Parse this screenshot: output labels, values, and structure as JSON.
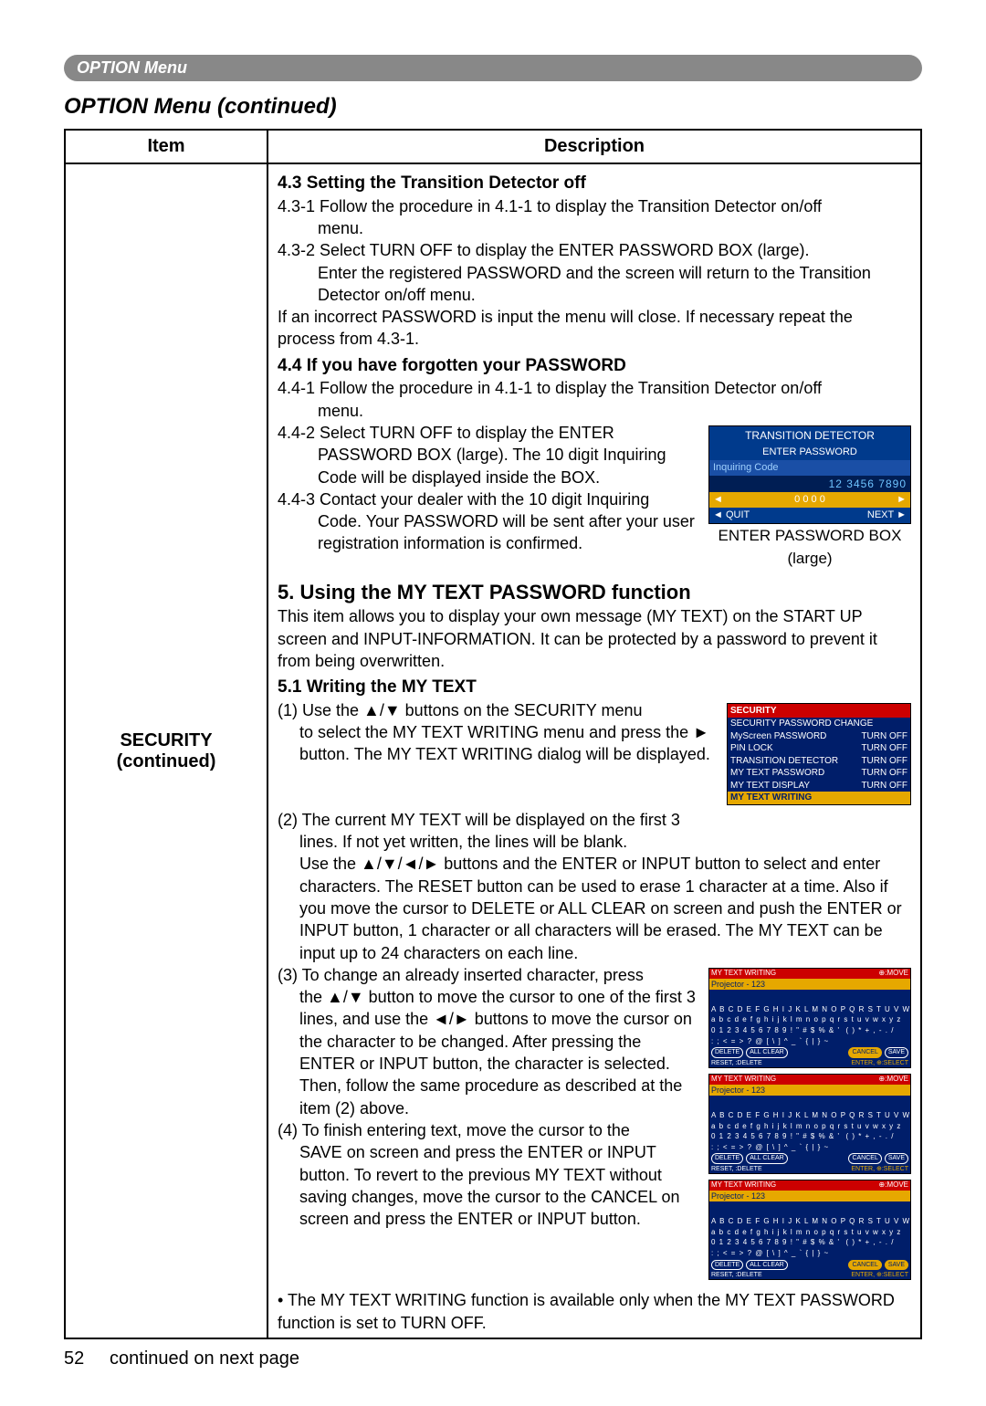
{
  "page": {
    "header_bar": "OPTION Menu",
    "section_title": "OPTION Menu (continued)",
    "page_number": "52",
    "continued": "continued on next page"
  },
  "table": {
    "col_item": "Item",
    "col_desc": "Description",
    "item_label_line1": "SECURITY",
    "item_label_line2": "(continued)"
  },
  "s43": {
    "title": "4.3 Setting the Transition Detector off",
    "p1a": "4.3-1 Follow the procedure in 4.1-1 to display the Transition Detector on/off",
    "p1b": "menu.",
    "p2a": "4.3-2 Select TURN OFF to display the ENTER PASSWORD BOX (large).",
    "p2b": "Enter the registered PASSWORD and the screen will return to the Transition Detector on/off menu.",
    "p3": "If an incorrect PASSWORD is input the menu will close. If necessary repeat the process from 4.3-1."
  },
  "s44": {
    "title": "4.4 If you have forgotten your PASSWORD",
    "p1a": "4.4-1 Follow the procedure in 4.1-1 to display the Transition Detector on/off",
    "p1b": "menu.",
    "p2a": "4.4-2 Select TURN OFF to display the ENTER",
    "p2b": "PASSWORD BOX (large). The 10 digit Inquiring Code will be displayed inside the BOX.",
    "p3a": "4.4-3 Contact your dealer with the 10 digit Inquiring",
    "p3b": "Code. Your PASSWORD will be sent after your user registration information is confirmed."
  },
  "s5": {
    "title": "5. Using the MY TEXT PASSWORD function",
    "intro": "This item allows you to display your own message (MY TEXT) on the START UP screen and INPUT-INFORMATION. It can be protected by a password to prevent it from being overwritten."
  },
  "s51": {
    "title": "5.1 Writing the MY TEXT",
    "p1a": "(1) Use the ▲/▼ buttons on the SECURITY menu",
    "p1b": "to select the MY TEXT WRITING menu and press the ► button. The MY TEXT WRITING dialog will be displayed.",
    "p2a": "(2) The current MY TEXT will be displayed on the first 3",
    "p2b": "lines. If not yet written, the lines will be blank.",
    "p2c": "Use the ▲/▼/◄/► buttons and the ENTER or INPUT button to select and enter characters. The RESET button can be used to erase 1 character at a time. Also if you move the cursor to DELETE or ALL CLEAR on screen and push the ENTER or INPUT button, 1 character or all characters will be erased. The MY TEXT can be input up to 24 characters on each line.",
    "p3a": "(3) To change an already inserted character, press",
    "p3b": "the ▲/▼ button to move the cursor to one of the first 3 lines, and use the ◄/► buttons to move the cursor on the character to be changed. After pressing the ENTER or INPUT button, the character is selected. Then, follow the same procedure as described at the item (2) above.",
    "p4a": "(4) To finish entering text, move the cursor to the",
    "p4b": "SAVE on screen and press the ENTER or INPUT button. To revert to the previous MY TEXT without saving changes, move the cursor to the CANCEL on screen and press the ENTER or INPUT button.",
    "note": "• The MY TEXT WRITING function is available only when the MY TEXT PASSWORD function is set to TURN OFF."
  },
  "pwbox": {
    "title1": "TRANSITION DETECTOR",
    "title2": "ENTER PASSWORD",
    "code_label": "Inquiring Code",
    "code_value": "12 3456 7890",
    "digits_row_left": "◄",
    "digits_row_val": "0 0 0 0",
    "digits_row_right": "►",
    "quit": "◄ QUIT",
    "next": "NEXT ►",
    "caption1": "ENTER PASSWORD BOX",
    "caption2": "(large)"
  },
  "secbox": {
    "hdr": "SECURITY",
    "r1": "SECURITY PASSWORD CHANGE",
    "r2l": "MyScreen PASSWORD",
    "r2r": "TURN OFF",
    "r3l": "PIN LOCK",
    "r3r": "TURN OFF",
    "r4l": "TRANSITION DETECTOR",
    "r4r": "TURN OFF",
    "r5l": "MY TEXT PASSWORD",
    "r5r": "TURN OFF",
    "r6l": "MY TEXT DISPLAY",
    "r6r": "TURN OFF",
    "r7": "MY TEXT WRITING"
  },
  "txtbox": {
    "bar_l": "MY TEXT WRITING",
    "bar_r": "⊕:MOVE",
    "input_line": "Projector - 123",
    "chars_upper": "A B C D E F G H I J K L M N O P Q R S T U V W X Y Z",
    "chars_lower": "a b c d e f g h i j k l m n o p q r s t u v w x y z",
    "chars_num": "0 1 2 3 4 5 6 7 8 9 ! \" # $ % & '  ( ) * + , - . /",
    "chars_sym": ": ; < = > ? @ [ \\ ] ^ _ ` { | } ~",
    "btn_delete": "DELETE",
    "btn_clear": "ALL CLEAR",
    "btn_cancel": "CANCEL",
    "btn_save": "SAVE",
    "foot_l": "RESET, :DELETE",
    "foot_r": "ENTER, ⊕:SELECT"
  }
}
